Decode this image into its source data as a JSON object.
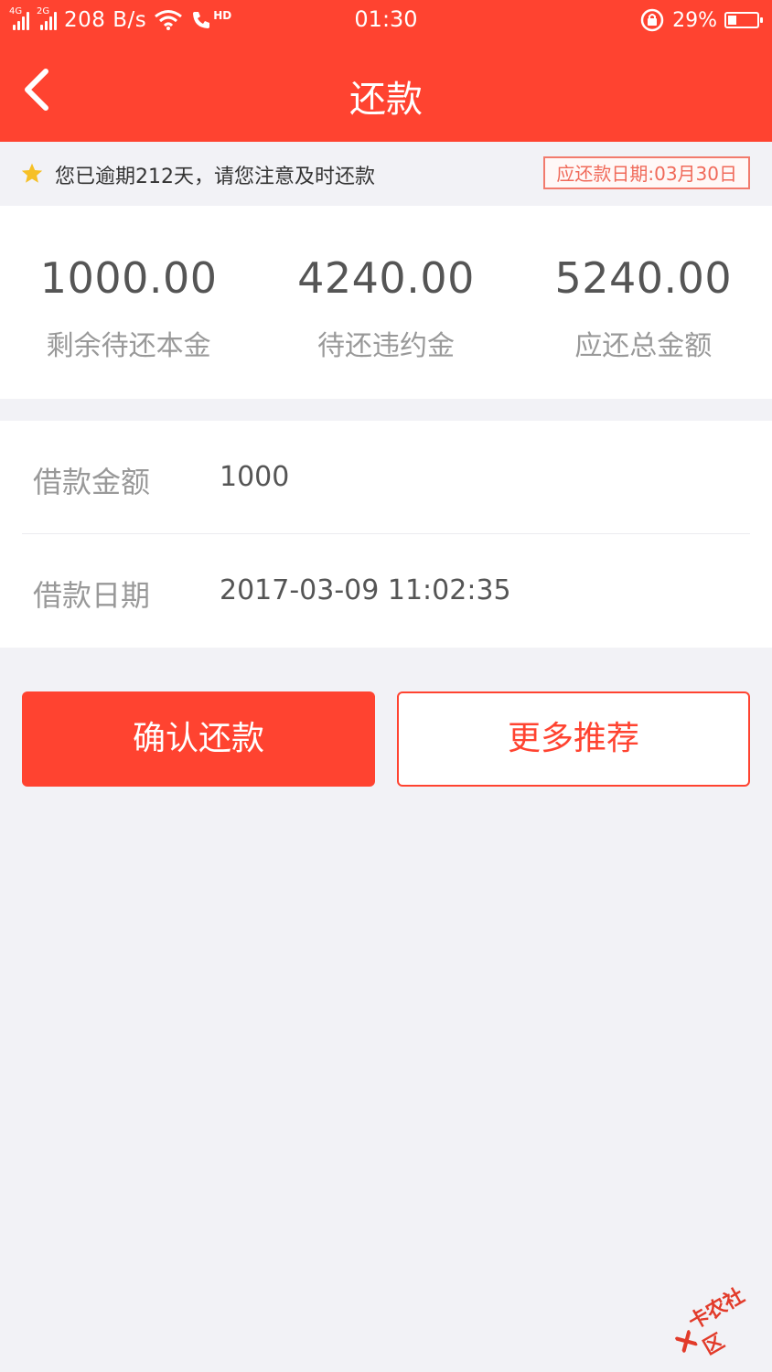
{
  "status_bar": {
    "signal1_label": "4G",
    "signal2_label": "2G",
    "speed": "208 B/s",
    "hd_label": "HD",
    "time": "01:30",
    "battery_percent_text": "29%",
    "battery_level": 0.29
  },
  "header": {
    "title": "还款"
  },
  "notice": {
    "text": "您已逾期212天，请您注意及时还款",
    "due_date": "应还款日期:03月30日",
    "star_color": "#f6c026"
  },
  "summary": [
    {
      "value": "1000.00",
      "label": "剩余待还本金"
    },
    {
      "value": "4240.00",
      "label": "待还违约金"
    },
    {
      "value": "5240.00",
      "label": "应还总金额"
    }
  ],
  "details": [
    {
      "label": "借款金额",
      "value": "1000"
    },
    {
      "label": "借款日期",
      "value": "2017-03-09 11:02:35"
    }
  ],
  "actions": {
    "confirm_label": "确认还款",
    "more_label": "更多推荐"
  },
  "watermark": {
    "text": "卡农社区"
  },
  "colors": {
    "brand": "#ff4330",
    "background": "#f2f2f6"
  }
}
